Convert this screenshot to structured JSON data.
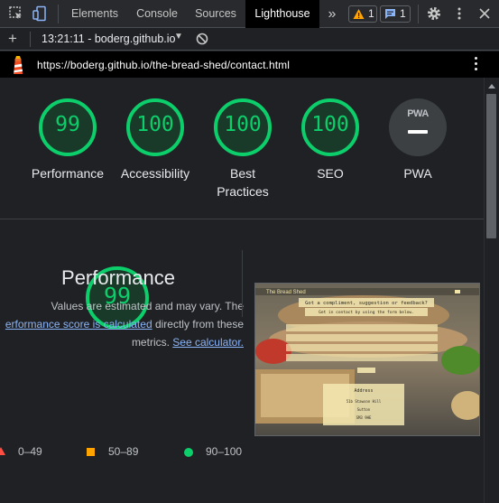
{
  "tabs": [
    {
      "label": "Elements"
    },
    {
      "label": "Console"
    },
    {
      "label": "Sources"
    },
    {
      "label": "Lighthouse"
    }
  ],
  "more_tabs": "»",
  "issues": {
    "warnings": "1",
    "messages": "1"
  },
  "toolbar": {
    "report_label": "13:21:11 - boderg.github.io",
    "caret": "▼"
  },
  "url": "https://boderg.github.io/the-bread-shed/contact.html",
  "categories": [
    {
      "score": "99",
      "label": "Performance",
      "score_num": 99
    },
    {
      "score": "100",
      "label": "Accessibility",
      "score_num": 100
    },
    {
      "score": "100",
      "label": "Best",
      "label2": "Practices",
      "score_num": 100
    },
    {
      "score": "100",
      "label": "SEO",
      "score_num": 100
    },
    {
      "score": "PWA",
      "label": "PWA"
    }
  ],
  "performance": {
    "score": "99",
    "score_num": 99,
    "title": "Performance",
    "desc_line1": "Values are estimated and may vary. The",
    "desc_link": "erformance score is calculated",
    "desc_line2": " directly from these",
    "desc_line3": "metrics. ",
    "calc_link": "See calculator."
  },
  "legend": [
    {
      "label": "0–49",
      "color": "#ff4e42"
    },
    {
      "label": "50–89",
      "color": "#ffa400"
    },
    {
      "label": "90–100",
      "color": "#0cce6b"
    }
  ],
  "screenshot": {
    "brand": "The Bread Shed",
    "heading": "Got a compliment, suggestion or feedback?",
    "subheading": "Get in contact by using the form below.",
    "address_title": "Address",
    "address_lines": [
      "51b Stawson Hill",
      "Sutton",
      "SM3 9HE"
    ]
  },
  "colors": {
    "pass": "#0cce6b",
    "average": "#ffa400",
    "fail": "#ff4e42",
    "link": "#8ab4f8",
    "active_tab": "#000000"
  }
}
